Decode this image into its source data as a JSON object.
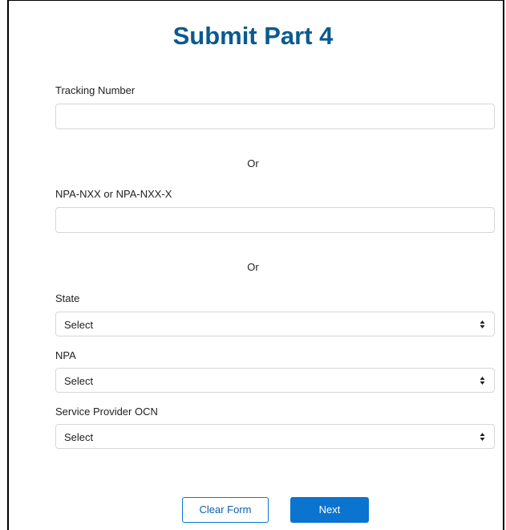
{
  "page": {
    "title": "Submit Part 4"
  },
  "form": {
    "tracking_number": {
      "label": "Tracking Number",
      "value": "",
      "placeholder": ""
    },
    "separator_1": "Or",
    "npa_nxx": {
      "label": "NPA-NXX or NPA-NXX-X",
      "value": "",
      "placeholder": ""
    },
    "separator_2": "Or",
    "state": {
      "label": "State",
      "selected": "Select"
    },
    "npa": {
      "label": "NPA",
      "selected": "Select"
    },
    "service_provider_ocn": {
      "label": "Service Provider OCN",
      "selected": "Select"
    }
  },
  "actions": {
    "clear_label": "Clear Form",
    "next_label": "Next"
  },
  "colors": {
    "title": "#0a5a8f",
    "primary": "#0a74cf",
    "border": "#d6d6d6"
  },
  "icons": {
    "select_arrow": "chevron-up-down-icon"
  }
}
